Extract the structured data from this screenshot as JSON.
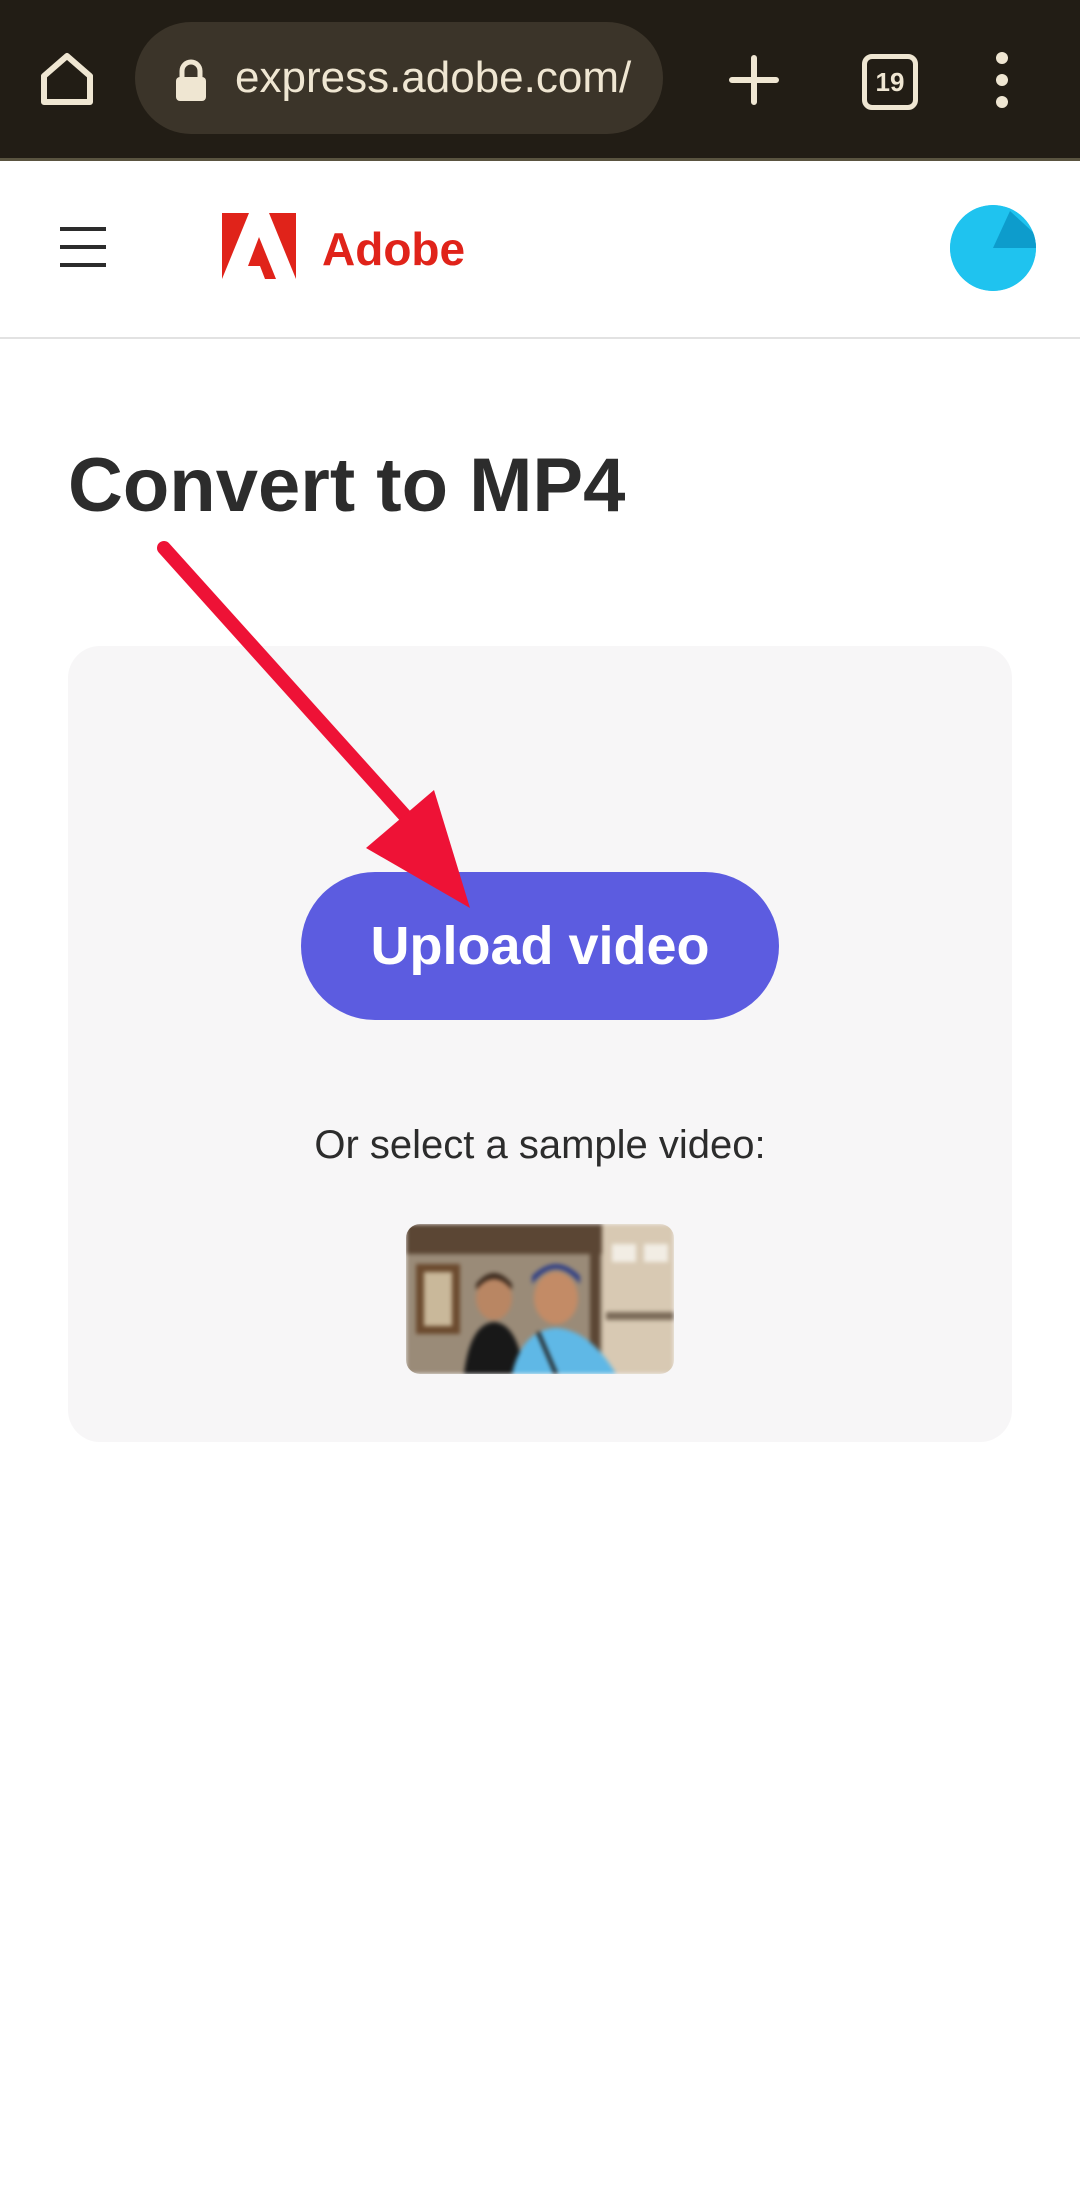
{
  "browser": {
    "url": "express.adobe.com/",
    "tab_count": "19",
    "icons": [
      "home-icon",
      "lock-icon",
      "plus-icon",
      "tabs-counter-icon",
      "more-vert-icon"
    ]
  },
  "header": {
    "brand": "Adobe",
    "icons": [
      "hamburger-menu-icon",
      "adobe-logo-icon",
      "avatar"
    ]
  },
  "main": {
    "title": "Convert to MP4",
    "upload_button_label": "Upload video",
    "sample_label": "Or select a sample video:",
    "annotation": "red-arrow-pointing-to-upload-button"
  },
  "colors": {
    "browser_bar": "#221d15",
    "adobe_red": "#e0231a",
    "upload_button": "#5c5ce0",
    "card_background": "#f7f6f7",
    "avatar": "#1fc3ef",
    "annotation_arrow": "#ee1236"
  }
}
